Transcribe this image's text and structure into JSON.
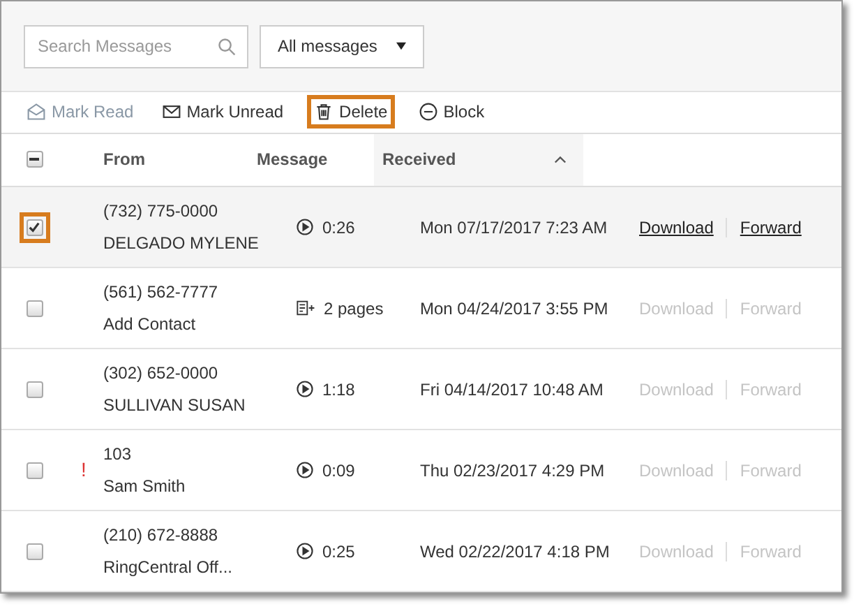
{
  "search": {
    "placeholder": "Search Messages"
  },
  "filter": {
    "value": "All messages"
  },
  "actions": [
    {
      "kind": "read",
      "label": "Mark Read",
      "disabled": true,
      "highlighted": false
    },
    {
      "kind": "unread",
      "label": "Mark Unread",
      "disabled": false,
      "highlighted": false
    },
    {
      "kind": "delete",
      "label": "Delete",
      "disabled": false,
      "highlighted": true
    },
    {
      "kind": "block",
      "label": "Block",
      "disabled": false,
      "highlighted": false
    }
  ],
  "header": {
    "indeterminate": true,
    "columns": [
      {
        "label": "From",
        "sorted": false
      },
      {
        "label": "Message",
        "sorted": false
      },
      {
        "label": "Received",
        "sorted": true
      }
    ]
  },
  "rows": [
    {
      "number": "(732) 775-0000",
      "name": "DELGADO MYLENE",
      "kind": "voicemail",
      "message": "0:26",
      "received": "Mon 07/17/2017 7:23 AM",
      "selected": true,
      "highlighted": true,
      "links": [
        "Download",
        "Forward"
      ]
    },
    {
      "number": "(561) 562-7777",
      "name": "Add Contact",
      "kind": "fax",
      "message": "2 pages",
      "received": "Mon 04/24/2017 3:55 PM",
      "selected": false,
      "highlighted": false,
      "links": [
        "Download",
        "Forward"
      ]
    },
    {
      "number": "(302) 652-0000",
      "name": "SULLIVAN SUSAN",
      "kind": "voicemail",
      "message": "1:18",
      "received": "Fri 04/14/2017 10:48 AM",
      "selected": false,
      "highlighted": false,
      "links": [
        "Download",
        "Forward"
      ]
    },
    {
      "number": "103",
      "name": "Sam Smith",
      "kind": "voicemail",
      "message": "0:09",
      "received": "Thu 02/23/2017 4:29 PM",
      "selected": false,
      "highlighted": false,
      "urgent_mark": "!",
      "links": [
        "Download",
        "Forward"
      ]
    },
    {
      "number": "(210) 672-8888",
      "name": "RingCentral Off...",
      "kind": "voicemail",
      "message": "0:25",
      "received": "Wed 02/22/2017 4:18 PM",
      "selected": false,
      "highlighted": false,
      "links": [
        "Download",
        "Forward"
      ]
    }
  ]
}
